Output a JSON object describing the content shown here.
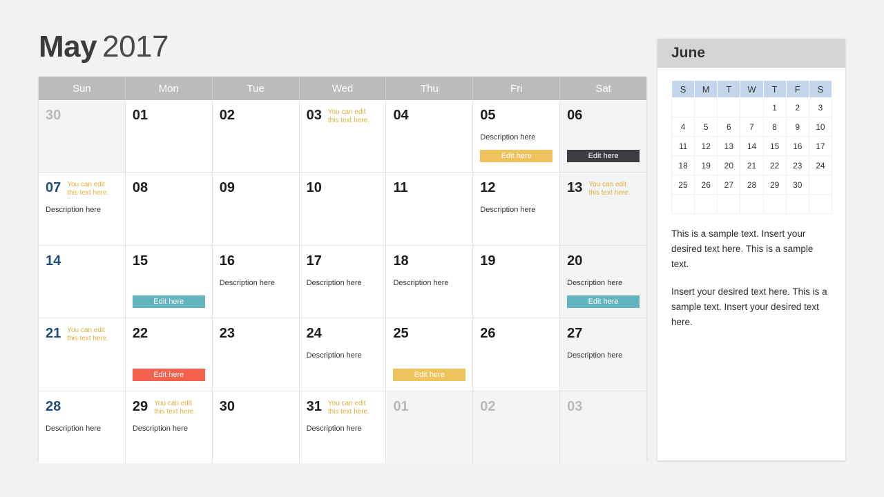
{
  "title": {
    "month": "May",
    "year": "2017"
  },
  "calendar": {
    "weekdays": [
      "Sun",
      "Mon",
      "Tue",
      "Wed",
      "Thu",
      "Fri",
      "Sat"
    ],
    "edit_button_label": "Edit here",
    "weeks": [
      [
        {
          "day": "30",
          "muted": true,
          "shaded": true,
          "note": "",
          "desc": "",
          "btn": ""
        },
        {
          "day": "01",
          "muted": false,
          "shaded": false,
          "note": "",
          "desc": "",
          "btn": ""
        },
        {
          "day": "02",
          "muted": false,
          "shaded": false,
          "note": "",
          "desc": "",
          "btn": ""
        },
        {
          "day": "03",
          "muted": false,
          "shaded": false,
          "note": "You can edit\nthis text here.",
          "desc": "",
          "btn": ""
        },
        {
          "day": "04",
          "muted": false,
          "shaded": false,
          "note": "",
          "desc": "",
          "btn": ""
        },
        {
          "day": "05",
          "muted": false,
          "shaded": false,
          "note": "",
          "desc": "Description here",
          "btn": "yellow"
        },
        {
          "day": "06",
          "muted": false,
          "shaded": true,
          "note": "",
          "desc": "",
          "btn": "dark"
        }
      ],
      [
        {
          "day": "07",
          "muted": false,
          "shaded": false,
          "sunday": true,
          "note": "You can edit\nthis text here.",
          "desc": "Description here",
          "btn": ""
        },
        {
          "day": "08",
          "muted": false,
          "shaded": false,
          "note": "",
          "desc": "",
          "btn": ""
        },
        {
          "day": "09",
          "muted": false,
          "shaded": false,
          "note": "",
          "desc": "",
          "btn": ""
        },
        {
          "day": "10",
          "muted": false,
          "shaded": false,
          "note": "",
          "desc": "",
          "btn": ""
        },
        {
          "day": "11",
          "muted": false,
          "shaded": false,
          "note": "",
          "desc": "",
          "btn": ""
        },
        {
          "day": "12",
          "muted": false,
          "shaded": false,
          "note": "",
          "desc": "Description here",
          "btn": ""
        },
        {
          "day": "13",
          "muted": false,
          "shaded": true,
          "note": "You can edit\nthis text here.",
          "desc": "",
          "btn": ""
        }
      ],
      [
        {
          "day": "14",
          "muted": false,
          "shaded": false,
          "sunday": true,
          "note": "",
          "desc": "",
          "btn": ""
        },
        {
          "day": "15",
          "muted": false,
          "shaded": false,
          "note": "",
          "desc": "",
          "btn": "teal"
        },
        {
          "day": "16",
          "muted": false,
          "shaded": false,
          "note": "",
          "desc": "Description here",
          "btn": ""
        },
        {
          "day": "17",
          "muted": false,
          "shaded": false,
          "note": "",
          "desc": "Description here",
          "btn": ""
        },
        {
          "day": "18",
          "muted": false,
          "shaded": false,
          "note": "",
          "desc": "Description here",
          "btn": ""
        },
        {
          "day": "19",
          "muted": false,
          "shaded": false,
          "note": "",
          "desc": "",
          "btn": ""
        },
        {
          "day": "20",
          "muted": false,
          "shaded": true,
          "note": "",
          "desc": "Description here",
          "btn": "teal"
        }
      ],
      [
        {
          "day": "21",
          "muted": false,
          "shaded": false,
          "sunday": true,
          "note": "You can edit\nthis text here.",
          "desc": "",
          "btn": ""
        },
        {
          "day": "22",
          "muted": false,
          "shaded": false,
          "note": "",
          "desc": "",
          "btn": "red"
        },
        {
          "day": "23",
          "muted": false,
          "shaded": false,
          "note": "",
          "desc": "",
          "btn": ""
        },
        {
          "day": "24",
          "muted": false,
          "shaded": false,
          "note": "",
          "desc": "Description here",
          "btn": ""
        },
        {
          "day": "25",
          "muted": false,
          "shaded": false,
          "note": "",
          "desc": "",
          "btn": "yellow"
        },
        {
          "day": "26",
          "muted": false,
          "shaded": false,
          "note": "",
          "desc": "",
          "btn": ""
        },
        {
          "day": "27",
          "muted": false,
          "shaded": true,
          "note": "",
          "desc": "Description here",
          "btn": ""
        }
      ],
      [
        {
          "day": "28",
          "muted": false,
          "shaded": false,
          "sunday": true,
          "note": "",
          "desc": "Description here",
          "btn": ""
        },
        {
          "day": "29",
          "muted": false,
          "shaded": false,
          "note": "You can edit\nthis text here.",
          "desc": "Description here",
          "btn": ""
        },
        {
          "day": "30",
          "muted": false,
          "shaded": false,
          "note": "",
          "desc": "",
          "btn": ""
        },
        {
          "day": "31",
          "muted": false,
          "shaded": false,
          "note": "You can edit\nthis text here.",
          "desc": "Description here",
          "btn": ""
        },
        {
          "day": "01",
          "muted": true,
          "shaded": true,
          "note": "",
          "desc": "",
          "btn": ""
        },
        {
          "day": "02",
          "muted": true,
          "shaded": true,
          "note": "",
          "desc": "",
          "btn": ""
        },
        {
          "day": "03",
          "muted": true,
          "shaded": true,
          "note": "",
          "desc": "",
          "btn": ""
        }
      ]
    ]
  },
  "sidebar": {
    "title": "June",
    "mini_calendar": {
      "weekdays": [
        "S",
        "M",
        "T",
        "W",
        "T",
        "F",
        "S"
      ],
      "weeks": [
        [
          "",
          "",
          "",
          "",
          "1",
          "2",
          "3"
        ],
        [
          "4",
          "5",
          "6",
          "7",
          "8",
          "9",
          "10"
        ],
        [
          "11",
          "12",
          "13",
          "14",
          "15",
          "16",
          "17"
        ],
        [
          "18",
          "19",
          "20",
          "21",
          "22",
          "23",
          "24"
        ],
        [
          "25",
          "26",
          "27",
          "28",
          "29",
          "30",
          ""
        ],
        [
          "",
          "",
          "",
          "",
          "",
          "",
          ""
        ]
      ]
    },
    "paragraphs": [
      "This is a sample text. Insert your desired text here. This is a sample text.",
      "Insert your desired text here. This is a sample text. Insert your desired text here."
    ]
  },
  "colors": {
    "yellow": "#eec35d",
    "dark": "#3c3c42",
    "teal": "#62b5bf",
    "red": "#f2604e",
    "sunday": "#1f4e79",
    "note": "#e0b138",
    "header_gray": "#bcbcbc",
    "mini_header_blue": "#c5d6ec"
  }
}
